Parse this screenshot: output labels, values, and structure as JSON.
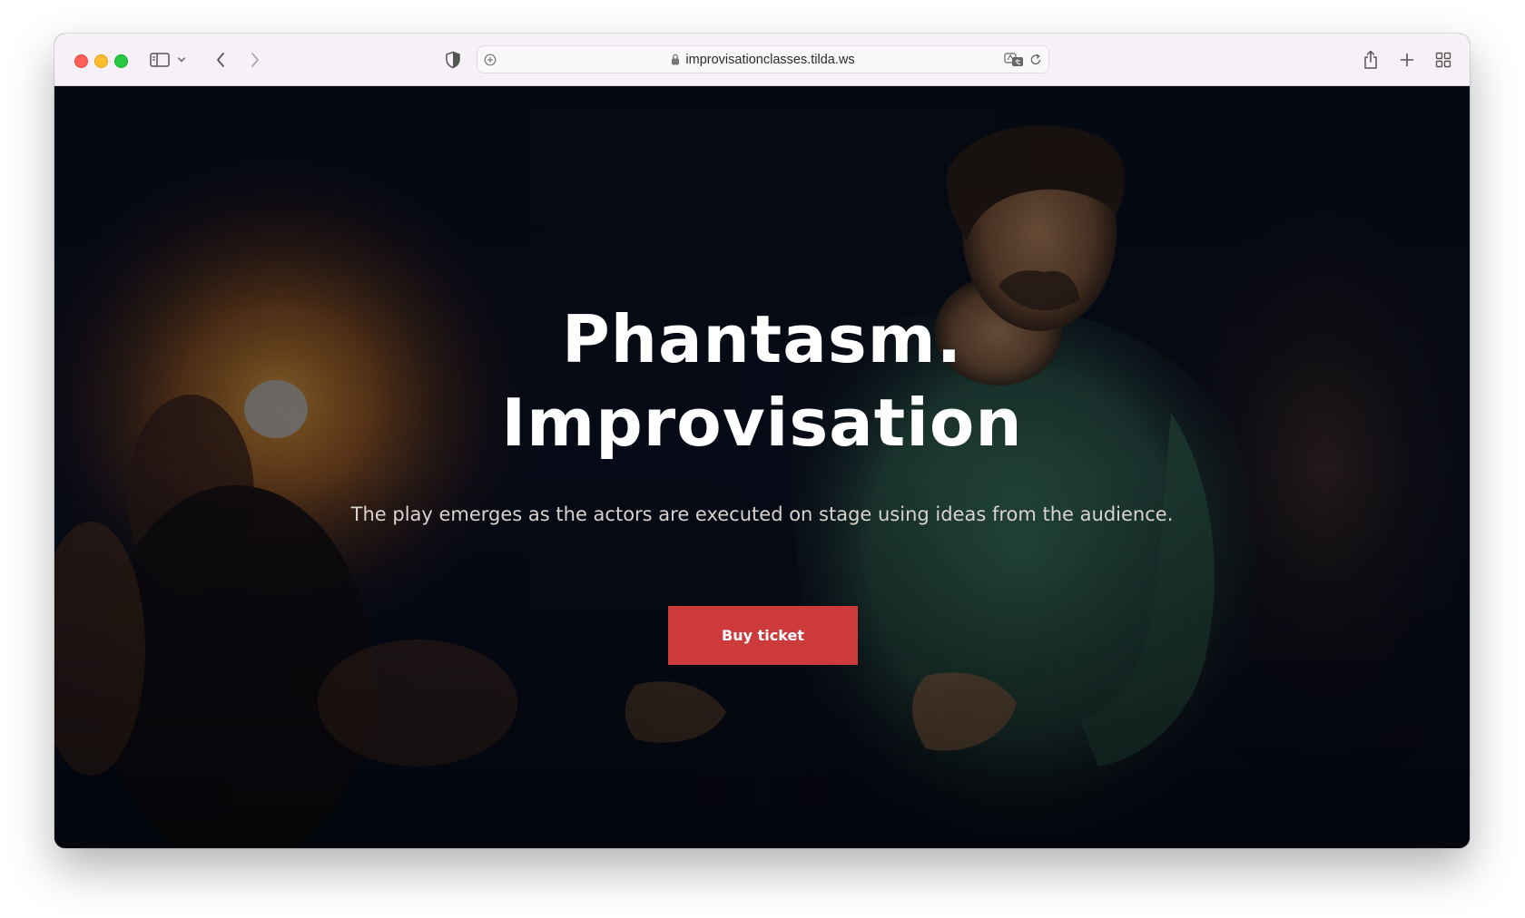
{
  "browser": {
    "url": "improvisationclasses.tilda.ws",
    "icons": {
      "close": "close-dot",
      "minimize": "minimize-dot",
      "maximize": "maximize-dot",
      "sidebar": "sidebar-icon",
      "chevron": "chevron-down-icon",
      "back": "back-arrow-icon",
      "forward": "forward-arrow-icon",
      "privacy": "shield-icon",
      "site_settings": "site-settings-icon",
      "lock": "lock-icon",
      "translate": "translate-icon",
      "reload": "reload-icon",
      "share": "share-icon",
      "new_tab": "plus-icon",
      "tab_overview": "tab-grid-icon"
    }
  },
  "hero": {
    "title_line1": "Phantasm.",
    "title_line2": "Improvisation",
    "subtitle": "The play emerges as the actors are executed on stage using ideas from the audience.",
    "cta_label": "Buy ticket",
    "cta_color": "#cc3a3c"
  }
}
